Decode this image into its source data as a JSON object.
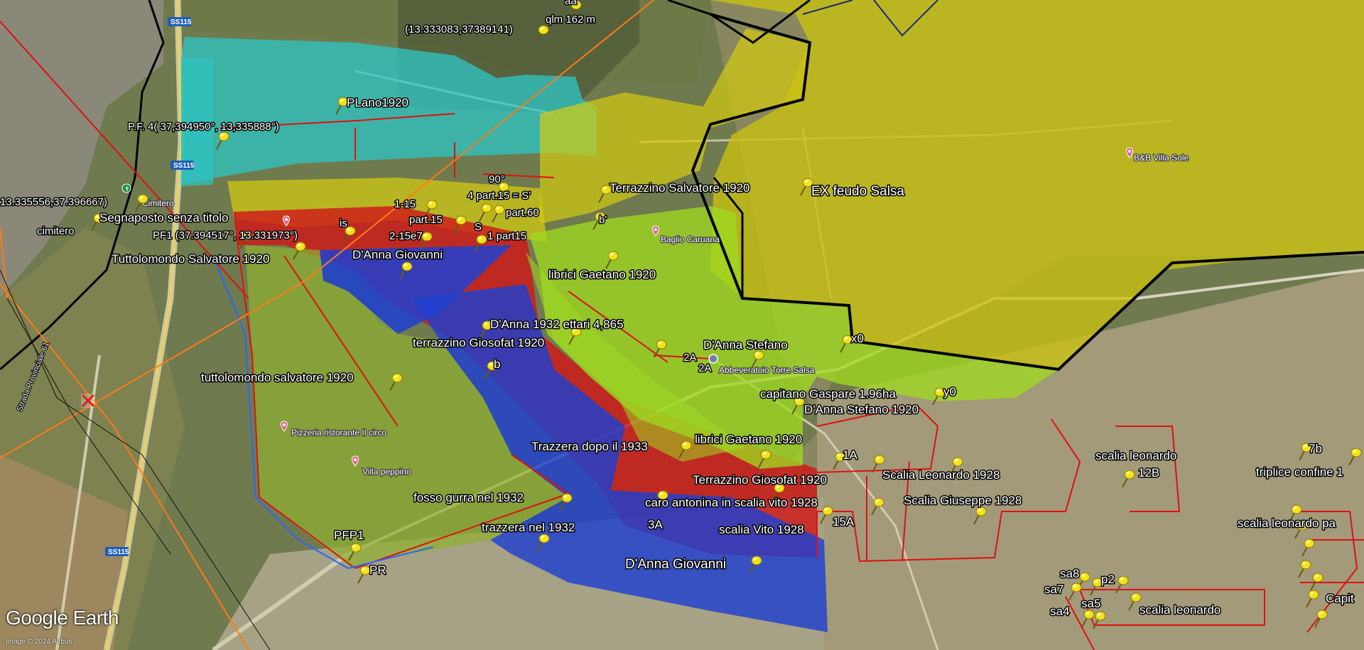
{
  "app": {
    "logo": "Google Earth",
    "copyright": "Image © 2024 Airbus"
  },
  "colors": {
    "cyan": "#2fc3c0",
    "yellow": "#d4cc10",
    "red": "#d01818",
    "blue": "#1e3fd0",
    "green": "#9fd820",
    "olive": "#8fb030",
    "boundary": "#000000",
    "redline": "#e01010",
    "orangeline": "#ff7a1a"
  },
  "road_labels": {
    "ss115_top": "SS115",
    "ss115_mid": "SS115",
    "ss115_bottom": "SS115",
    "provinciale": "Strada Provinciale 61"
  },
  "poi_labels": {
    "cimitero_poi": "Cimitero",
    "bb": "B&B Villa Sole",
    "baglio": "Baglio Caruana",
    "abbeveratoio": "Abbeveratoio Torre Salsa",
    "pizzeria": "Pizzeria ristorante Il circo",
    "villa": "Villa peppino"
  },
  "placemark_icon": "yellow-pushpin-icon",
  "placemarks": {
    "aa": "aa",
    "qlm": "qlm 162 m",
    "coord_top": "(13.333083,37389141)",
    "plano": "PLano1920",
    "pf4": "P.F. 4( 37,394950°, 13,335888°)",
    "coord_left": "13.335556,37.396667)",
    "segnaposto": "Segnaposto senza titolo",
    "cimitero": "cimitero",
    "pf1": "PF1  (37.394517°, 13.331973°)",
    "is": "is",
    "tuttolomondo": "Tuttolomondo Salvatore 1920",
    "dep90": "90°",
    "part4": "4 part.15 = S'",
    "l115": "1-15",
    "part15": "part.15",
    "part60": "part.60",
    "s": "S",
    "l215": "2-15e7",
    "part15b": "1 part15",
    "terrazzino_salv": "Terrazzino Salvatore 1920",
    "bprime": "b'",
    "ex_feudo": "EX feudo Salsa",
    "danna_giov_top": "D'Anna Giovanni",
    "librici_top": "librici Gaetano 1920",
    "danna1932": "D'Anna 1932  ettari 4,865",
    "terrazzino_gios1": "terrazzino Giosofat 1920",
    "b": "b",
    "danna_stefano": "D'Anna Stefano",
    "x0": "x0",
    "a2": "2A",
    "a2b": "2A",
    "tutto_low": "tuttolomondo salvatore 1920",
    "capitano": "capitano Gaspare 1.96ha",
    "y0": "y0",
    "danna_stefano1920": "D'Anna Stefano 1920",
    "librici_low": "librici Gaetano 1920",
    "trazzera1933": "Trazzera dopo il 1933",
    "a1": "1A",
    "scalia_leo1928": "Scalia Leonardo 1928",
    "scalia_leo": "scalia leonardo",
    "b12": "12B",
    "b7": "7b",
    "triplice": "triplice confine 1",
    "terrazzino_gios2": "Terrazzino Giosofat 1920",
    "fosso": "fosso gurra nel 1932",
    "caro": "caro antonina in scalia vito 1928",
    "scalia_gius": "Scalia Giuseppe 1928",
    "a3": "3A",
    "a15": "15A",
    "scalia_leo_pa": "scalia leonardo pa",
    "trazzera1932": "trazzera nel 1932",
    "scalia_vito": "scalia Vito 1928",
    "pfp1": "PFP1",
    "pr": "PR",
    "danna_giov_bot": "D'Anna Giovanni",
    "sa8": "sa8",
    "p2": "p2",
    "sa7": "sa7",
    "sa5": "sa5",
    "sa4": "sa4",
    "scalia_leo_bot": "scalia leonardo",
    "capit": "Capit"
  }
}
